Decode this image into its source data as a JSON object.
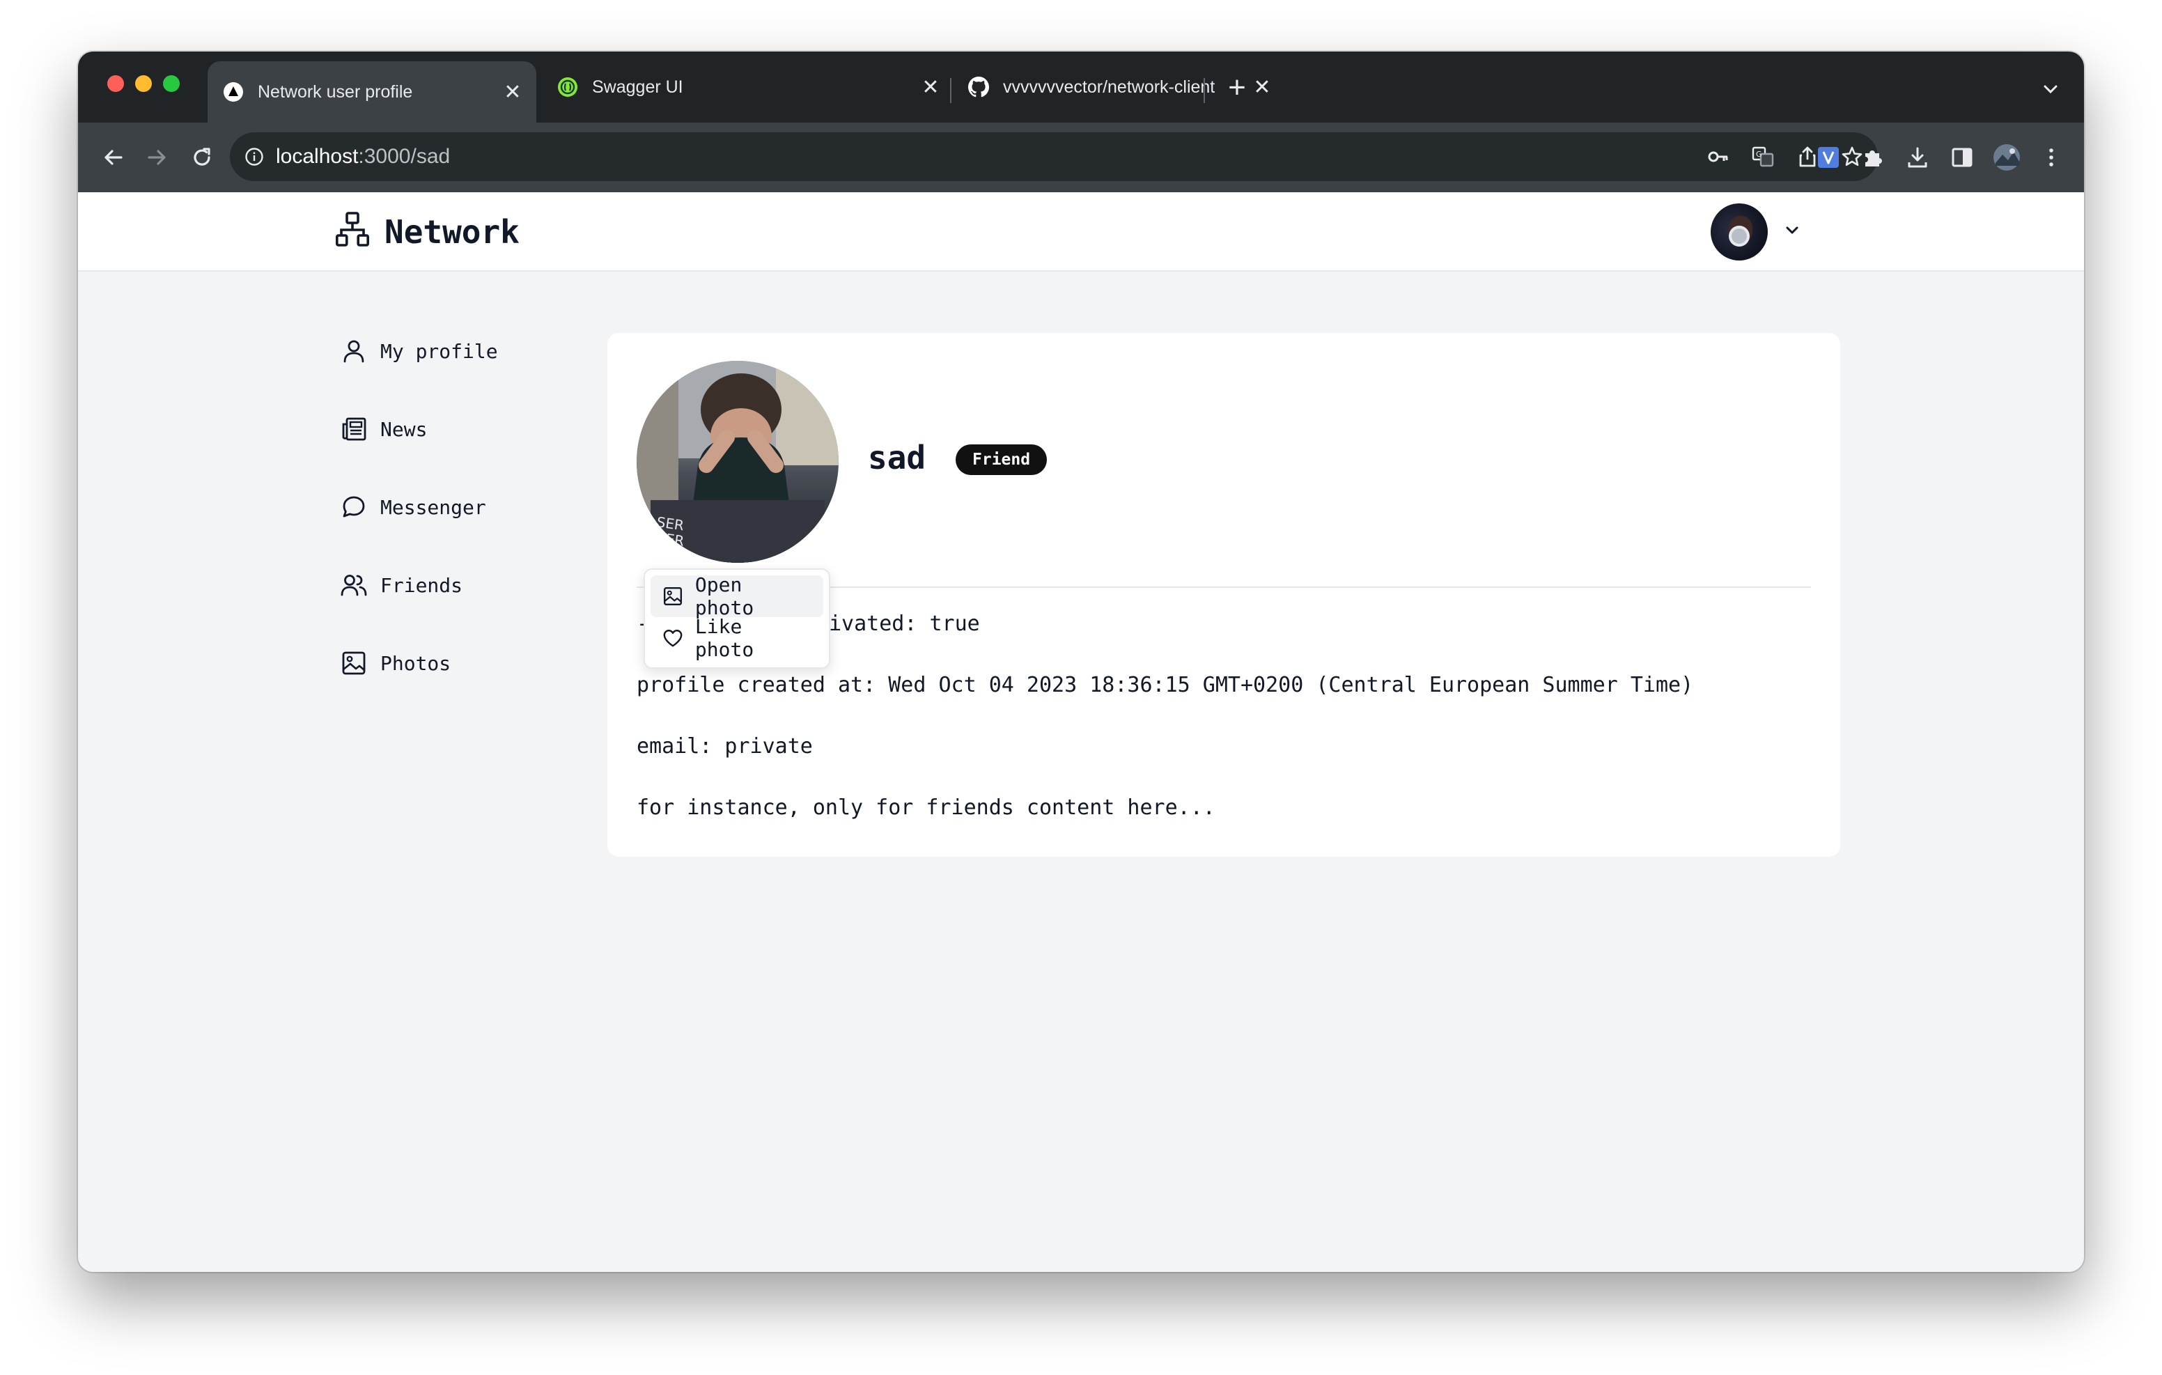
{
  "browser": {
    "tabs": [
      {
        "title": "Network user profile",
        "icon": "triangle-logo-icon",
        "active": true
      },
      {
        "title": "Swagger UI",
        "icon": "swagger-icon",
        "active": false
      },
      {
        "title": "vvvvvvvector/network-client",
        "icon": "github-icon",
        "active": false
      }
    ],
    "tab_close_glyph": "✕",
    "new_tab_glyph": "+",
    "url_host": "localhost",
    "url_path": ":3000/sad"
  },
  "app": {
    "brand": "Network",
    "nav": [
      {
        "label": "My profile",
        "icon": "user-icon"
      },
      {
        "label": "News",
        "icon": "newspaper-icon"
      },
      {
        "label": "Messenger",
        "icon": "chat-bubble-icon"
      },
      {
        "label": "Friends",
        "icon": "users-icon"
      },
      {
        "label": "Photos",
        "icon": "image-icon"
      }
    ]
  },
  "profile": {
    "username": "sad",
    "badge": "Friend",
    "info_partial_visible": "ivated: true",
    "info_partial_prefix": "-",
    "created_at": "profile created at: Wed Oct 04 2023 18:36:15 GMT+0200 (Central European Summer Time)",
    "email": "email: private",
    "friends_content": "for instance, only for friends content here..."
  },
  "context_menu": {
    "items": [
      {
        "label": "Open photo",
        "icon": "image-icon"
      },
      {
        "label": "Like photo",
        "icon": "heart-icon"
      }
    ]
  },
  "colors": {
    "accent_dark": "#111111",
    "page_bg": "#f3f4f6",
    "browser_frame": "#3b4145"
  }
}
